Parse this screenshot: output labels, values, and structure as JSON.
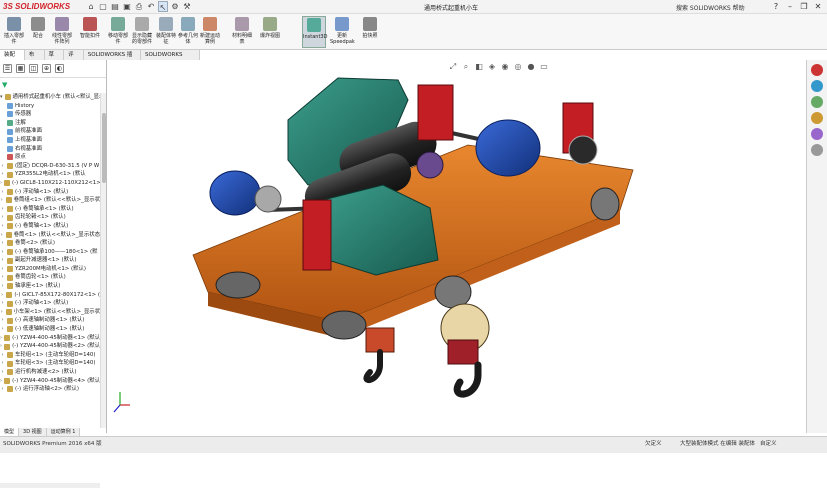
{
  "app": {
    "logo": "3S SOLIDWORKS",
    "window_title": "通用桥式起重机小车",
    "search_placeholder": "搜索 SOLIDWORKS 帮助"
  },
  "ribbon": {
    "buttons": [
      {
        "label": "插入零部件",
        "color": "#7a8fa8"
      },
      {
        "label": "配合",
        "color": "#8d8d8d"
      },
      {
        "label": "线性零部件阵列",
        "color": "#98a"
      },
      {
        "label": "智能扣件",
        "color": "#b55"
      },
      {
        "label": "移动零部件",
        "color": "#7a9"
      },
      {
        "label": "显示隐藏的零部件",
        "color": "#aaa"
      },
      {
        "label": "装配体特征",
        "color": "#9ab"
      },
      {
        "label": "参考几何体",
        "color": "#8ab"
      },
      {
        "label": "新建运动算例",
        "color": "#c86"
      },
      {
        "label": "材料明细表",
        "color": "#a9a"
      },
      {
        "label": "爆炸视图",
        "color": "#9a8"
      },
      {
        "label": "Instant3D",
        "color": "#5a9"
      },
      {
        "label": "更新Speedpak",
        "color": "#79c"
      },
      {
        "label": "拍快照",
        "color": "#888"
      }
    ]
  },
  "tabs": [
    "装配体",
    "布局",
    "草图",
    "评估",
    "SOLIDWORKS 插件",
    "SOLIDWORKS MBD"
  ],
  "tree": {
    "root": "通用桥式起重机小车 (默认<默认_显示状",
    "items": [
      {
        "t": "History",
        "k": "ref"
      },
      {
        "t": "传感器",
        "k": "ref"
      },
      {
        "t": "注解",
        "k": "note"
      },
      {
        "t": "前视基准面",
        "k": "ref"
      },
      {
        "t": "上视基准面",
        "k": "ref"
      },
      {
        "t": "右视基准面",
        "k": "ref"
      },
      {
        "t": "原点",
        "k": "orig"
      },
      {
        "t": "(固定) DCQR-D-630-31.5 (V P W",
        "k": ""
      },
      {
        "t": "YZR355L2电动机<1> (默认",
        "k": ""
      },
      {
        "t": "(-) GICL8-110X212-110X212<1>",
        "k": ""
      },
      {
        "t": "(-) 浮动轴<1> (默认)",
        "k": ""
      },
      {
        "t": "卷筒组<1> (默认<<默认>_显示状",
        "k": ""
      },
      {
        "t": "(-) 卷筒轴承<1> (默认)",
        "k": ""
      },
      {
        "t": "齿轮轮毂<1> (默认)",
        "k": ""
      },
      {
        "t": "(-) 卷筒轴<1> (默认)",
        "k": ""
      },
      {
        "t": "卷筒<1> (默认<<默认>_显示状态",
        "k": ""
      },
      {
        "t": "卷筒<2> (默认)",
        "k": ""
      },
      {
        "t": "(-) 卷筒轴承100——180<1> (默",
        "k": ""
      },
      {
        "t": "副起升减速器<1> (默认)",
        "k": ""
      },
      {
        "t": "YZR200M电动机<1> (默认)",
        "k": ""
      },
      {
        "t": "卷筒齿轮<1> (默认)",
        "k": ""
      },
      {
        "t": "轴承座<1> (默认)",
        "k": ""
      },
      {
        "t": "(-) GICL7-85X172-80X172<1> (",
        "k": ""
      },
      {
        "t": "(-) 浮动轴<1> (默认)",
        "k": ""
      },
      {
        "t": "小车架<1> (默认<<默认>_显示状",
        "k": ""
      },
      {
        "t": "(-) 高速轴制动器<1> (默认)",
        "k": ""
      },
      {
        "t": "(-) 低速轴制动器<1> (默认)",
        "k": ""
      },
      {
        "t": "(-) YZW4-400-45制动器<1> (默认",
        "k": ""
      },
      {
        "t": "(-) YZW4-400-45制动器<2> (默认",
        "k": ""
      },
      {
        "t": "车轮组<1> (主动车轮组D=140)",
        "k": ""
      },
      {
        "t": "车轮组<3> (主动车轮组D=140)",
        "k": ""
      },
      {
        "t": "运行机构减速<2> (默认)",
        "k": ""
      },
      {
        "t": "(-) YZW4-400-45制动器<4> (默认",
        "k": ""
      },
      {
        "t": "(-) 运行浮动轴<2> (默认)",
        "k": ""
      }
    ]
  },
  "bottom_tabs": [
    "模型",
    "3D 视图",
    "运动算例 1"
  ],
  "status": {
    "left": "SOLIDWORKS Premium 2016 x64 版",
    "r1": "欠定义",
    "r2": "大型装配体模式 在编辑 装配体",
    "r3": "自定义"
  }
}
